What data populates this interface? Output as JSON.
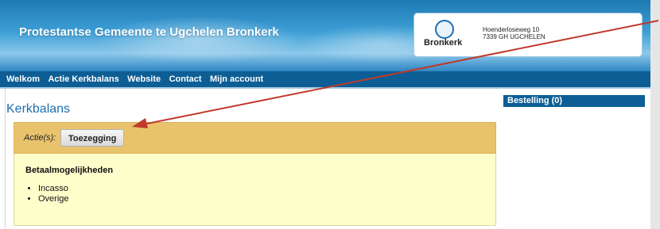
{
  "site": {
    "title": "Protestantse Gemeente te Ugchelen Bronkerk",
    "logo_text": "Bronkerk",
    "address_line1": "Hoenderloseweg 10",
    "address_line2": "7339 GH UGCHELEN"
  },
  "nav": {
    "items": [
      {
        "label": "Welkom"
      },
      {
        "label": "Actie Kerkbalans"
      },
      {
        "label": "Website"
      },
      {
        "label": "Contact"
      },
      {
        "label": "Mijn account"
      }
    ]
  },
  "page": {
    "title": "Kerkbalans",
    "actions_label": "Actie(s):",
    "action_button": "Toezegging",
    "section_title": "Betaalmogelijkheden",
    "payment_options": [
      "Incasso",
      "Overige"
    ]
  },
  "sidebar": {
    "order_label": "Bestelling (0)"
  },
  "colors": {
    "header_blue": "#1f79b3",
    "nav_blue": "#0d5e95",
    "title_blue": "#1e6fb0",
    "action_bar": "#e9c36c",
    "content_bg": "#fefecb",
    "annotation_arrow": "#c0392b"
  }
}
